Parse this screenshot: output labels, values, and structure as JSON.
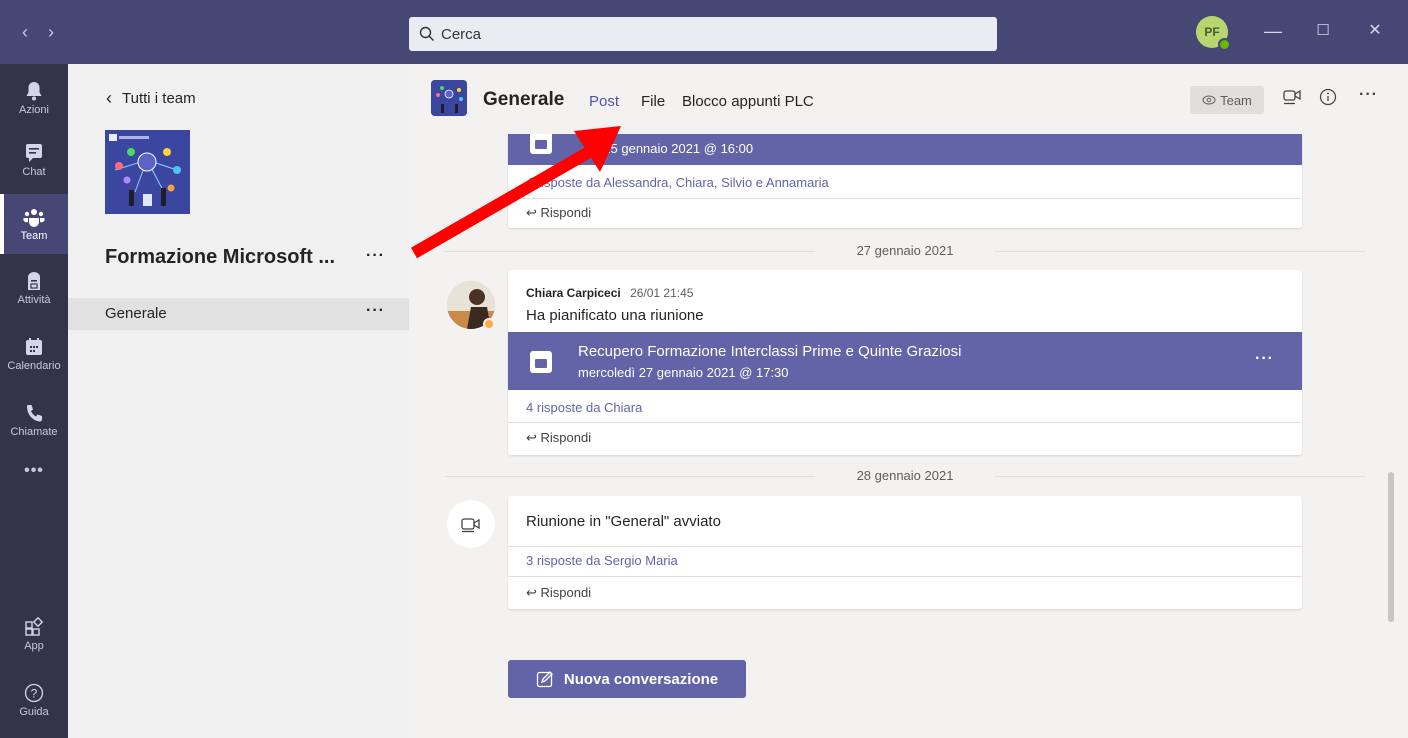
{
  "titlebar": {
    "back_icon": "chevron-left-icon",
    "forward_icon": "chevron-right-icon",
    "search_placeholder": "Cerca",
    "avatar_initials": "PF",
    "minimize": "—",
    "maximize": "☐",
    "close": "✕"
  },
  "rail": {
    "items": [
      {
        "label": "Azioni",
        "icon": "bell-icon"
      },
      {
        "label": "Chat",
        "icon": "chat-icon"
      },
      {
        "label": "Team",
        "icon": "teams-icon"
      },
      {
        "label": "Attività",
        "icon": "assignments-icon"
      },
      {
        "label": "Calendario",
        "icon": "calendar-icon"
      },
      {
        "label": "Chiamate",
        "icon": "phone-icon"
      },
      {
        "label": "•••",
        "icon": "more-icon"
      },
      {
        "label": "App",
        "icon": "apps-icon"
      },
      {
        "label": "Guida",
        "icon": "help-icon"
      }
    ]
  },
  "team_panel": {
    "back_label": "Tutti i team",
    "team_name": "Formazione Microsoft ...",
    "more": "···",
    "channel": {
      "name": "Generale",
      "more": "···"
    }
  },
  "header": {
    "channel_title": "Generale",
    "tabs": [
      {
        "label": "Post",
        "active": true
      },
      {
        "label": "File",
        "active": false
      },
      {
        "label": "Blocco appunti PLC",
        "active": false
      }
    ],
    "team_pill": "Team",
    "more": "···"
  },
  "feed": {
    "card1": {
      "banner_sub": "...dì 25 gennaio 2021 @ 16:00",
      "replies": "4 risposte da Alessandra, Chiara, Silvio e Annamaria",
      "reply": "Rispondi",
      "more": "···"
    },
    "date1": "27 gennaio 2021",
    "card2": {
      "author": "Chiara Carpiceci",
      "time": "26/01 21:45",
      "text": "Ha pianificato una riunione",
      "banner_title": "Recupero Formazione Interclassi Prime e Quinte Graziosi",
      "banner_sub": "mercoledì 27 gennaio 2021 @ 17:30",
      "more": "···",
      "replies": "4 risposte da Chiara",
      "reply": "Rispondi"
    },
    "date2": "28 gennaio 2021",
    "card3": {
      "text": "Riunione in \"General\" avviato",
      "replies": "3 risposte da Sergio Maria",
      "reply": "Rispondi"
    }
  },
  "compose": {
    "label": "Nuova conversazione"
  },
  "colors": {
    "accent": "#6264a7",
    "titlebar": "#464775",
    "rail": "#33344a",
    "arrow": "#ff0000"
  }
}
